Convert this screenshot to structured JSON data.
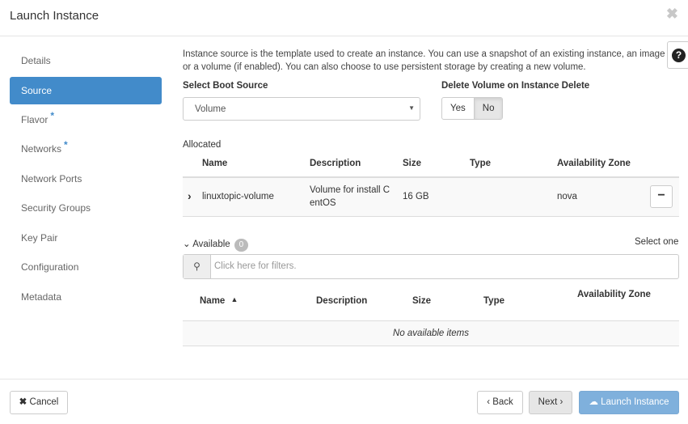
{
  "modal": {
    "title": "Launch Instance",
    "close": "✖"
  },
  "sidebar": {
    "items": [
      {
        "label": "Details",
        "required": ""
      },
      {
        "label": "Source",
        "required": ""
      },
      {
        "label": "Flavor",
        "required": "*"
      },
      {
        "label": "Networks",
        "required": "*"
      },
      {
        "label": "Network Ports",
        "required": ""
      },
      {
        "label": "Security Groups",
        "required": ""
      },
      {
        "label": "Key Pair",
        "required": ""
      },
      {
        "label": "Configuration",
        "required": ""
      },
      {
        "label": "Metadata",
        "required": ""
      }
    ],
    "active": "Source"
  },
  "source": {
    "help_line1": "Instance source is the template used to create an instance. You can use a snapshot of an existing instance, an image",
    "help_line2": "or a volume (if enabled). You can also choose to use persistent storage by creating a new volume.",
    "boot_source_label": "Select Boot Source",
    "boot_source_value": "Volume",
    "delete_volume_label": "Delete Volume on Instance Delete",
    "delete_yes": "Yes",
    "delete_no": "No",
    "allocated_label": "Allocated",
    "allocated_headers": {
      "name": "Name",
      "description": "Description",
      "size": "Size",
      "type": "Type",
      "zone": "Availability Zone"
    },
    "allocated_rows": [
      {
        "name": "linuxtopic-volume",
        "description_l1": "Volume for install C",
        "description_l2": "entOS",
        "size": "16 GB",
        "type": "",
        "zone": "nova"
      }
    ],
    "available_label": "Available",
    "available_count": "0",
    "select_one": "Select one",
    "filter_placeholder": "Click here for filters.",
    "available_headers": {
      "name": "Name",
      "description": "Description",
      "size": "Size",
      "type": "Type",
      "zone": "Availability Zone"
    },
    "empty_text": "No available items"
  },
  "footer": {
    "cancel": "Cancel",
    "back": "Back",
    "next": "Next",
    "launch": "Launch Instance"
  }
}
